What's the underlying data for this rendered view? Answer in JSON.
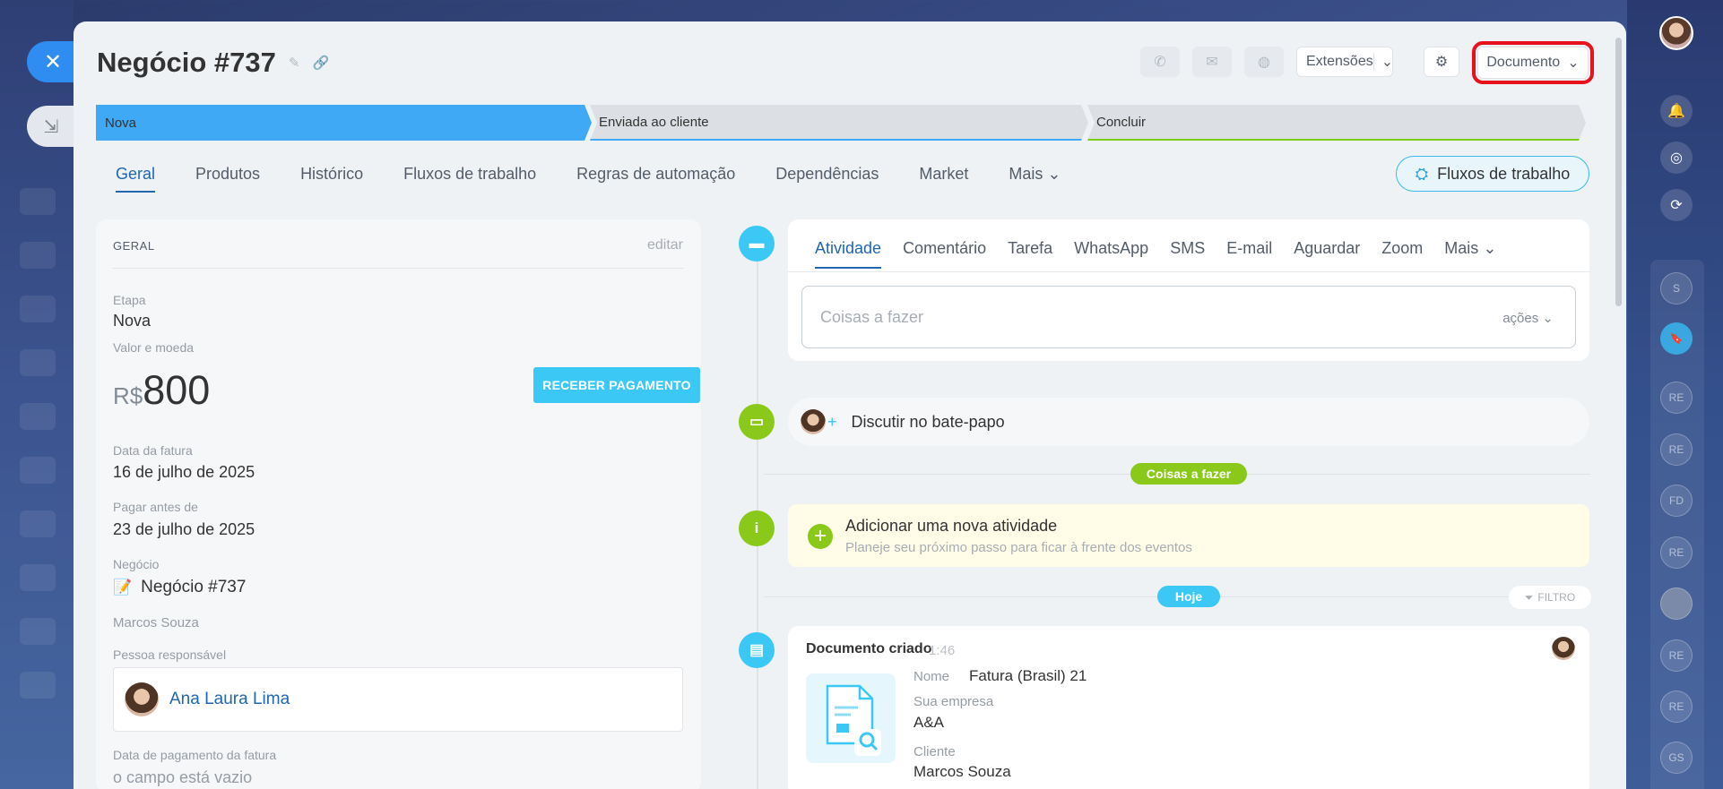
{
  "deal": {
    "title": "Negócio #737"
  },
  "header": {
    "extensions_label": "Extensões",
    "document_label": "Documento"
  },
  "stages": [
    {
      "label": "Nova"
    },
    {
      "label": "Enviada ao cliente"
    },
    {
      "label": "Concluir"
    }
  ],
  "tabs": [
    {
      "label": "Geral"
    },
    {
      "label": "Produtos"
    },
    {
      "label": "Histórico"
    },
    {
      "label": "Fluxos de trabalho"
    },
    {
      "label": "Regras de automação"
    },
    {
      "label": "Dependências"
    },
    {
      "label": "Market"
    },
    {
      "label": "Mais"
    }
  ],
  "workflows_button": "Fluxos de trabalho",
  "general": {
    "heading": "GERAL",
    "edit": "editar",
    "stage_label": "Etapa",
    "stage_value": "Nova",
    "amount_label": "Valor e moeda",
    "currency": "R$",
    "amount": "800",
    "pay_button": "RECEBER PAGAMENTO",
    "invoice_date_label": "Data da fatura",
    "invoice_date": "16 de julho de 2025",
    "due_label": "Pagar antes de",
    "due_date": "23 de julho de 2025",
    "deal_label": "Negócio",
    "deal_value": "Negócio #737",
    "client": "Marcos Souza",
    "responsible_label": "Pessoa responsável",
    "responsible": "Ana Laura Lima",
    "payment_date_label": "Data de pagamento da fatura",
    "payment_date_value": "o campo está vazio"
  },
  "activity": {
    "tabs": [
      "Atividade",
      "Comentário",
      "Tarefa",
      "WhatsApp",
      "SMS",
      "E-mail",
      "Aguardar",
      "Zoom",
      "Mais"
    ],
    "todo_placeholder": "Coisas a fazer",
    "actions": "ações",
    "chat": "Discutir no bate-papo",
    "todo_pill": "Coisas a fazer",
    "new_title": "Adicionar uma nova atividade",
    "new_sub": "Planeje seu próximo passo para ficar à frente dos eventos",
    "today_pill": "Hoje",
    "filter": "FILTRO"
  },
  "document": {
    "title": "Documento criado",
    "time": "1:46",
    "name_label": "Nome",
    "name": "Fatura (Brasil) 21",
    "company_label": "Sua empresa",
    "company": "A&A",
    "client_label": "Cliente",
    "client": "Marcos Souza"
  },
  "sidebar_users": [
    "S",
    "",
    "RE",
    "RE",
    "FD",
    "RE",
    "",
    "RE",
    "RE",
    "GS"
  ],
  "colors": {
    "accent": "#2067b0",
    "stage_active": "#3fa9f5",
    "pay_button": "#3bc8f5",
    "green": "#8ac919",
    "highlight": "#e8121d"
  }
}
